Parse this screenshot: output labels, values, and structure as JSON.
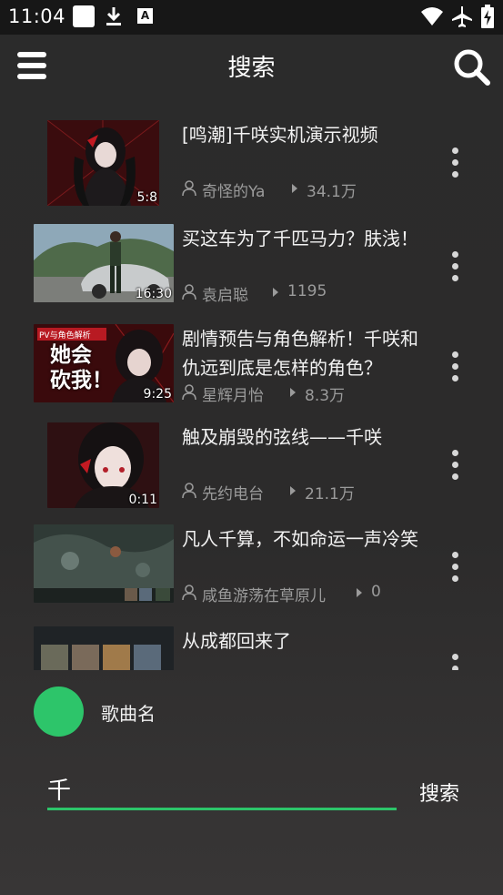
{
  "status_bar": {
    "time": "11:04",
    "indicator_letter": "A",
    "icons": [
      "white-square-icon",
      "download-icon",
      "a-badge-icon",
      "wifi-icon",
      "airplane-icon",
      "battery-charging-icon"
    ]
  },
  "app_bar": {
    "title": "搜索",
    "menu_icon": "menu-icon",
    "search_icon": "search-icon"
  },
  "videos": [
    {
      "title": "[鸣潮]千咲实机演示视频",
      "author": "奇怪的Ya",
      "views": "34.1万",
      "duration": "5:8"
    },
    {
      "title": "买这车为了千匹马力？肤浅！",
      "author": "袁启聪",
      "views": "1195",
      "duration": "16:30"
    },
    {
      "title": "剧情预告与角色解析！千咲和仇远到底是怎样的角色？",
      "author": "星辉月怡",
      "views": "8.3万",
      "duration": "9:25",
      "thumb_text_1": "PV与角色解析",
      "thumb_text_2": "她会",
      "thumb_text_3": "砍我！"
    },
    {
      "title": "触及崩毁的弦线——千咲",
      "author": "先约电台",
      "views": "21.1万",
      "duration": "0:11"
    },
    {
      "title": "凡人千算，不如命运一声冷笑",
      "author": "咸鱼游荡在草原儿",
      "views": "0",
      "duration": ""
    },
    {
      "title": "从成都回来了",
      "author": "",
      "views": "",
      "duration": ""
    }
  ],
  "player": {
    "song_name": "歌曲名",
    "accent_color": "#2dc56a"
  },
  "search": {
    "value": "千",
    "button_label": "搜索"
  }
}
